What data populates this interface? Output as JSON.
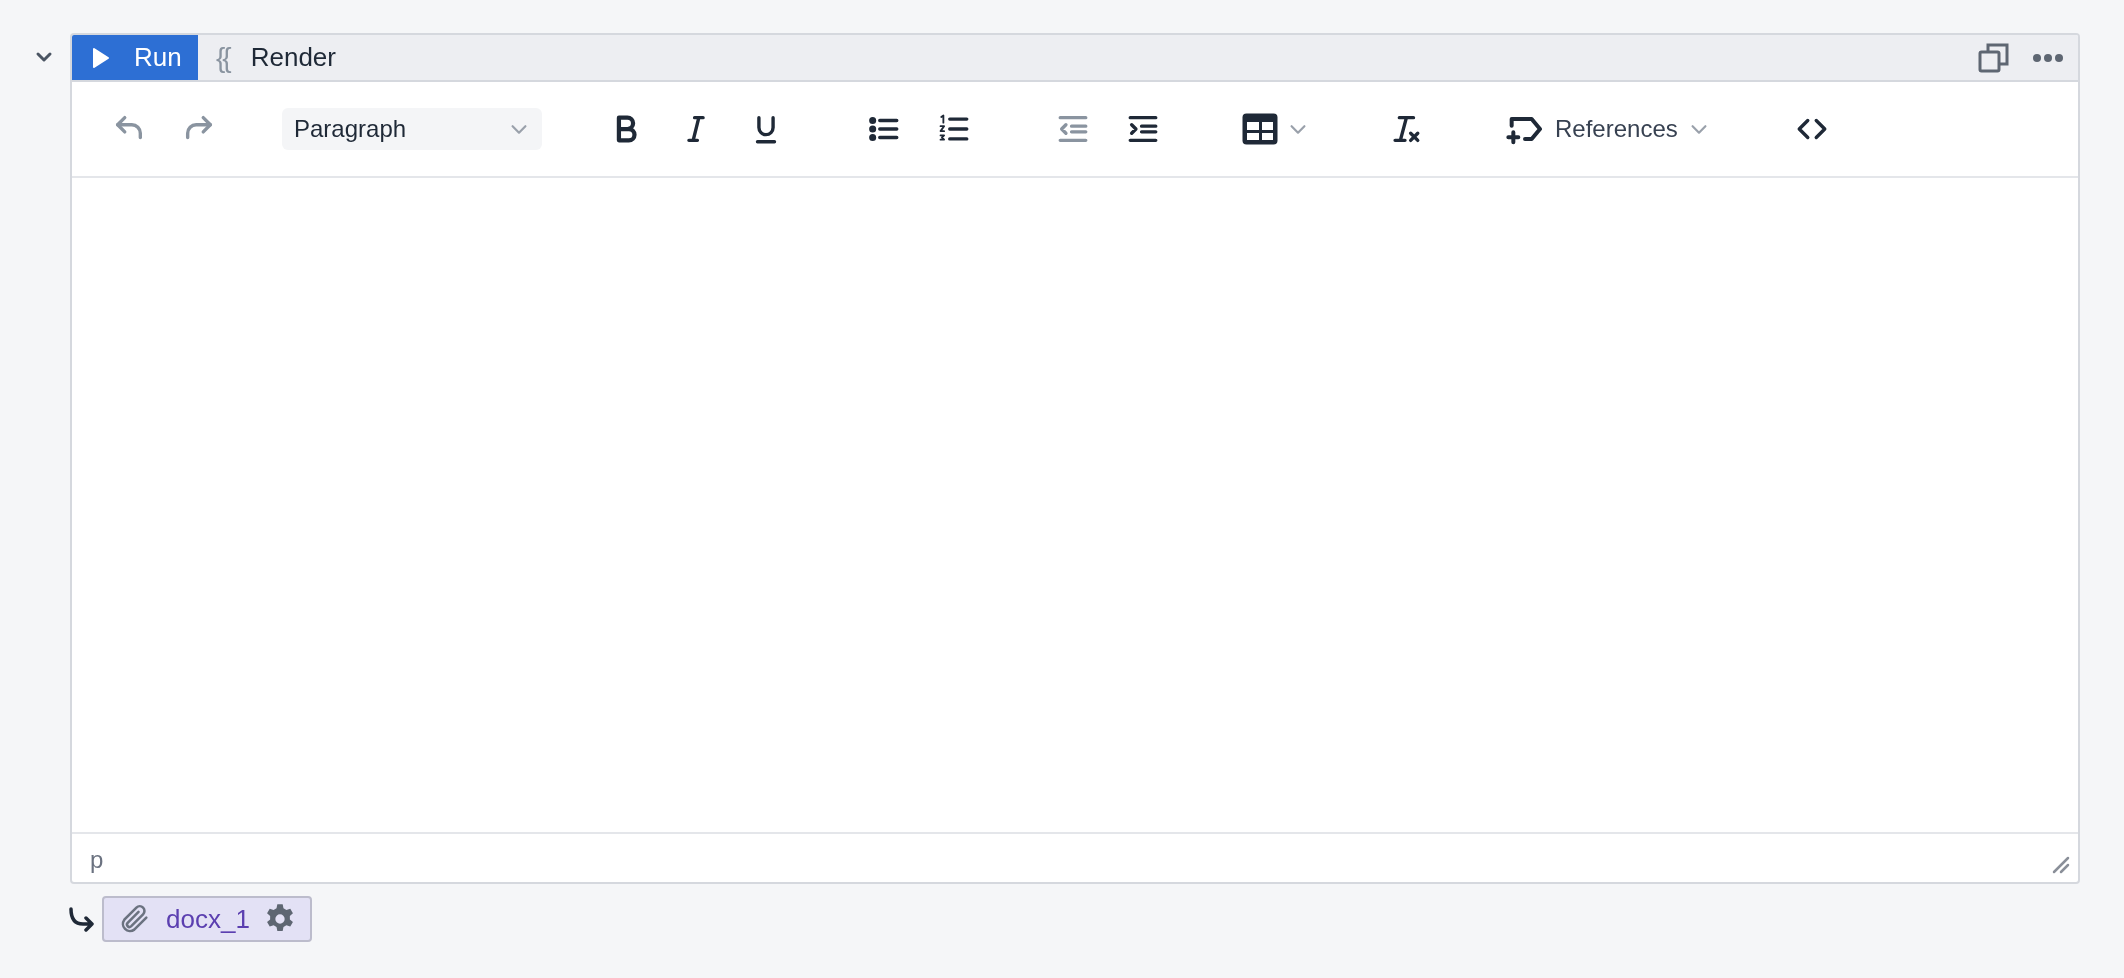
{
  "cell": {
    "expanded": true
  },
  "header": {
    "run_button": "Run",
    "template_mark": "{{",
    "title": "Render"
  },
  "toolbar": [
    {
      "kind": "undo",
      "disabled": true
    },
    {
      "kind": "redo",
      "disabled": true
    },
    {
      "kind": "select",
      "value": "Paragraph"
    },
    {
      "kind": "bold",
      "disabled": false
    },
    {
      "kind": "italic",
      "disabled": false
    },
    {
      "kind": "underline",
      "disabled": false
    },
    {
      "kind": "bullets",
      "disabled": false
    },
    {
      "kind": "numbers",
      "disabled": false
    },
    {
      "kind": "outdent",
      "disabled": true
    },
    {
      "kind": "indent",
      "disabled": false
    },
    {
      "kind": "table",
      "disabled": false
    },
    {
      "kind": "clear",
      "disabled": false
    },
    {
      "kind": "references",
      "label": "References",
      "disabled": false
    },
    {
      "kind": "code",
      "disabled": false
    }
  ],
  "status_bar": {
    "path": "p"
  },
  "attachment": {
    "label": "docx_1"
  }
}
